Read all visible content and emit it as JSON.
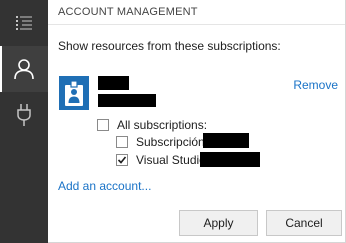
{
  "sidebar": {
    "items": [
      {
        "icon": "list-icon"
      },
      {
        "icon": "person-icon",
        "active": true
      },
      {
        "icon": "plug-icon"
      }
    ]
  },
  "panel": {
    "title": "ACCOUNT MANAGEMENT",
    "instruction": "Show resources from these subscriptions:"
  },
  "account": {
    "remove_label": "Remove",
    "avatar_icon": "id-badge-icon"
  },
  "subscriptions": {
    "all_label": "All subscriptions:",
    "all_checked": false,
    "items": [
      {
        "label": "Subscripción",
        "checked": false
      },
      {
        "label": "Visual Studio",
        "checked": true
      }
    ]
  },
  "actions": {
    "add_account": "Add an account...",
    "apply": "Apply",
    "cancel": "Cancel"
  },
  "colors": {
    "link": "#1a73c7",
    "sidebar_bg": "#333333",
    "avatar": "#1f6fb5"
  }
}
